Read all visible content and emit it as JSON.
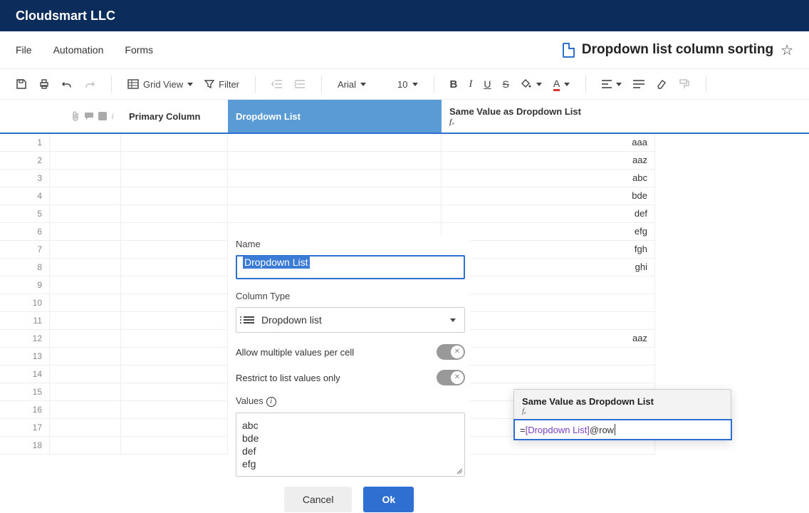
{
  "brand": "Cloudsmart LLC",
  "menu": {
    "file": "File",
    "automation": "Automation",
    "forms": "Forms"
  },
  "doc_title": "Dropdown list column sorting",
  "toolbar": {
    "grid_view": "Grid View",
    "filter": "Filter",
    "font": "Arial",
    "font_size": "10"
  },
  "columns": {
    "primary": "Primary Column",
    "dd": "Dropdown List",
    "same": "Same Value as Dropdown List",
    "fx": "fₓ"
  },
  "row_numbers": [
    "1",
    "2",
    "3",
    "4",
    "5",
    "6",
    "7",
    "8",
    "9",
    "10",
    "11",
    "12",
    "13",
    "14",
    "15",
    "16",
    "17",
    "18"
  ],
  "same_values": [
    "aaa",
    "aaz",
    "abc",
    "bde",
    "def",
    "efg",
    "fgh",
    "ghi",
    "",
    "",
    "",
    "aaz",
    "",
    "",
    "",
    "",
    "",
    ""
  ],
  "dialog": {
    "name_label": "Name",
    "name_value": "Dropdown List",
    "column_type_label": "Column Type",
    "column_type_value": "Dropdown list",
    "allow_multiple": "Allow multiple values per cell",
    "restrict": "Restrict to list values only",
    "values_label": "Values",
    "values_text": "abc\nbde\ndef\nefg",
    "cancel": "Cancel",
    "ok": "Ok"
  },
  "popover": {
    "title": "Same Value as Dropdown List",
    "fx": "fₓ",
    "formula_prefix": "=",
    "formula_ref": "[Dropdown List]",
    "formula_suffix": "@row"
  }
}
